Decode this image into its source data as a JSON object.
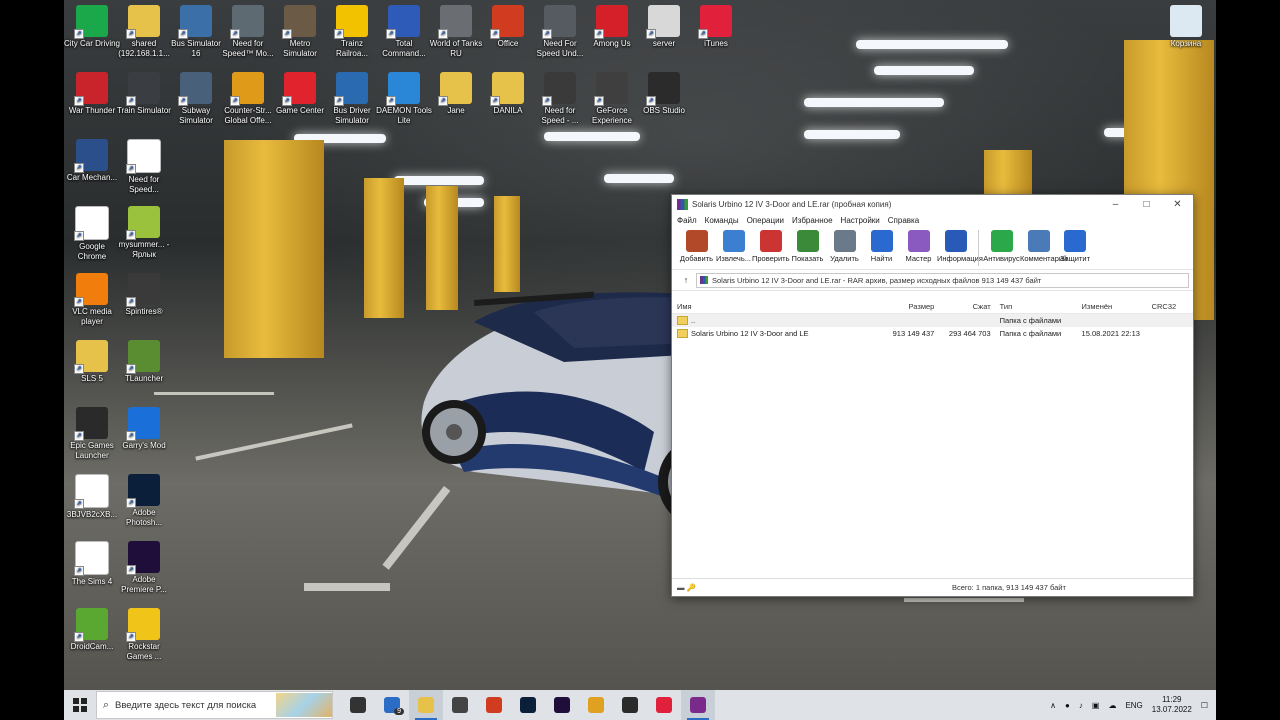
{
  "desktop": {
    "icons": [
      {
        "label": "City Car Driving",
        "icon": "green-circle-icon",
        "color": "#1aa84a"
      },
      {
        "label": "shared (192.168.1.1...",
        "icon": "folder-icon",
        "color": "#e7c24a"
      },
      {
        "label": "Bus Simulator 16",
        "icon": "bus-icon",
        "color": "#3b6fa8"
      },
      {
        "label": "Need for Speed™ Mo...",
        "icon": "nfs-mw-icon",
        "color": "#5e6a72"
      },
      {
        "label": "Metro Simulator",
        "icon": "metro-icon",
        "color": "#6a5a46"
      },
      {
        "label": "Trainz Railroa...",
        "icon": "trainz-icon",
        "color": "#f2c100"
      },
      {
        "label": "Total Command...",
        "icon": "floppy-icon",
        "color": "#2e5bb8"
      },
      {
        "label": "World of Tanks RU",
        "icon": "wot-icon",
        "color": "#6a6e72"
      },
      {
        "label": "Office",
        "icon": "office-icon",
        "color": "#d13b1f"
      },
      {
        "label": "Need For Speed Und...",
        "icon": "nfs-icon",
        "color": "#555b60"
      },
      {
        "label": "Among Us",
        "icon": "among-us-icon",
        "color": "#d5202a"
      },
      {
        "label": "server",
        "icon": "server-icon",
        "color": "#d8d8d8"
      },
      {
        "label": "iTunes",
        "icon": "music-icon",
        "color": "#e1203c"
      },
      {
        "label": "War Thunder",
        "icon": "war-thunder-icon",
        "color": "#c9242c"
      },
      {
        "label": "Train Simulator",
        "icon": "ts-icon",
        "color": "#3a3d42"
      },
      {
        "label": "Subway Simulator",
        "icon": "subway-icon",
        "color": "#48607a"
      },
      {
        "label": "Counter-Str... Global Offe...",
        "icon": "csgo-icon",
        "color": "#e09a1a"
      },
      {
        "label": "Game Center",
        "icon": "game-center-icon",
        "color": "#e0232c"
      },
      {
        "label": "Bus Driver Simulator",
        "icon": "bus-driver-icon",
        "color": "#2a6ab0"
      },
      {
        "label": "DAEMON Tools Lite",
        "icon": "daemon-icon",
        "color": "#2a86d6"
      },
      {
        "label": "Jane",
        "icon": "folder-icon",
        "color": "#e7c24a"
      },
      {
        "label": "DANILA",
        "icon": "folder-icon",
        "color": "#e7c24a"
      },
      {
        "label": "Need for Speed - ...",
        "icon": "nfs-icon",
        "color": "#3a3a3a"
      },
      {
        "label": "GeForce Experience",
        "icon": "geforce-icon",
        "color": "#3f3f3f"
      },
      {
        "label": "OBS Studio",
        "icon": "obs-icon",
        "color": "#2b2b2b"
      },
      {
        "label": "Car Mechan...",
        "icon": "car-mechanic-icon",
        "color": "#2a4f8a"
      },
      {
        "label": "Need for Speed...",
        "icon": "nfs-icon",
        "color": "#ffffff"
      },
      {
        "label": "Google Chrome",
        "icon": "chrome-icon",
        "color": "#ffffff"
      },
      {
        "label": "mysummer... - Ярлык",
        "icon": "mysummer-icon",
        "color": "#9bc23c"
      },
      {
        "label": "VLC media player",
        "icon": "vlc-icon",
        "color": "#f07d0c"
      },
      {
        "label": "Spintires®",
        "icon": "spintires-icon",
        "color": "#3a3a3a"
      },
      {
        "label": "SLS 5",
        "icon": "folder-icon",
        "color": "#e7c24a"
      },
      {
        "label": "TLauncher",
        "icon": "minecraft-icon",
        "color": "#5a8c32"
      },
      {
        "label": "Epic Games Launcher",
        "icon": "epic-icon",
        "color": "#2a2a2a"
      },
      {
        "label": "Garry's Mod",
        "icon": "gmod-icon",
        "color": "#1a6fd8"
      },
      {
        "label": "3BJVB2cXB...",
        "icon": "image-file-icon",
        "color": "#ffffff"
      },
      {
        "label": "Adobe Photosh...",
        "icon": "photoshop-icon",
        "color": "#0c1f3a"
      },
      {
        "label": "The Sims 4",
        "icon": "sims-icon",
        "color": "#ffffff"
      },
      {
        "label": "Adobe Premiere P...",
        "icon": "premiere-icon",
        "color": "#1f0e3a"
      },
      {
        "label": "DroidCam...",
        "icon": "droidcam-icon",
        "color": "#5aa832"
      },
      {
        "label": "Rockstar Games ...",
        "icon": "rockstar-icon",
        "color": "#f0c419"
      },
      {
        "label": "Корзина",
        "icon": "recycle-bin-icon",
        "color": "#dce8f2"
      }
    ]
  },
  "window": {
    "title": "Solaris Urbino 12 IV 3-Door and LE.rar (пробная копия)",
    "menu": [
      "Файл",
      "Команды",
      "Операции",
      "Избранное",
      "Настройки",
      "Справка"
    ],
    "toolbar": [
      {
        "label": "Добавить",
        "icon": "add-archive-icon",
        "color": "#b24a2a"
      },
      {
        "label": "Извлечь...",
        "icon": "extract-folder-icon",
        "color": "#3c7fd0"
      },
      {
        "label": "Проверить",
        "icon": "test-clipboard-icon",
        "color": "#c33"
      },
      {
        "label": "Показать",
        "icon": "view-book-icon",
        "color": "#3a8a3a"
      },
      {
        "label": "Удалить",
        "icon": "delete-bin-icon",
        "color": "#6b7a8a"
      },
      {
        "label": "Найти",
        "icon": "find-magnifier-icon",
        "color": "#2a6ad0"
      },
      {
        "label": "Мастер",
        "icon": "wizard-wand-icon",
        "color": "#8a5ac0"
      },
      {
        "label": "Информация",
        "icon": "info-icon",
        "color": "#2a5ab8"
      },
      {
        "label": "Антивирус",
        "icon": "antivirus-icon",
        "color": "#2aa84a"
      },
      {
        "label": "Комментарий",
        "icon": "comment-icon",
        "color": "#4a7ab8"
      },
      {
        "label": "Защитит",
        "icon": "protect-shield-icon",
        "color": "#2a6ad0"
      }
    ],
    "address": "Solaris Urbino 12 IV 3-Door and LE.rar - RAR архив, размер исходных файлов 913 149 437 байт",
    "columns": [
      "Имя",
      "Размер",
      "Сжат",
      "Тип",
      "Изменён",
      "CRC32"
    ],
    "rows": [
      {
        "name": "..",
        "size": "",
        "packed": "",
        "type": "Папка с файлами",
        "modified": "",
        "crc": ""
      },
      {
        "name": "Solaris Urbino 12 IV 3-Door and LE",
        "size": "913 149 437",
        "packed": "293 464 703",
        "type": "Папка с файлами",
        "modified": "15.08.2021 22:13",
        "crc": ""
      }
    ],
    "status": "Всего: 1 папка, 913 149 437 байт"
  },
  "taskbar": {
    "search_placeholder": "Введите здесь текст для поиска",
    "mail_badge": "9",
    "apps": [
      {
        "name": "task-view",
        "icon": "task-view-icon",
        "color": "#333333"
      },
      {
        "name": "mail",
        "icon": "mail-icon",
        "color": "#2b6cc4"
      },
      {
        "name": "explorer",
        "icon": "folder-icon",
        "color": "#e7c24a"
      },
      {
        "name": "store",
        "icon": "store-icon",
        "color": "#444444"
      },
      {
        "name": "office",
        "icon": "office-icon",
        "color": "#d13b1f"
      },
      {
        "name": "photoshop",
        "icon": "photoshop-icon",
        "color": "#0c1f3a"
      },
      {
        "name": "premiere",
        "icon": "premiere-icon",
        "color": "#1f0e3a"
      },
      {
        "name": "chrome",
        "icon": "chrome-icon",
        "color": "#e0a020"
      },
      {
        "name": "obs",
        "icon": "obs-icon",
        "color": "#2b2b2b"
      },
      {
        "name": "itunes",
        "icon": "music-icon",
        "color": "#e1203c"
      },
      {
        "name": "winrar",
        "icon": "winrar-icon",
        "color": "#7a2a8a"
      }
    ],
    "language": "ENG",
    "time": "11:29",
    "date": "13.07.2022"
  }
}
